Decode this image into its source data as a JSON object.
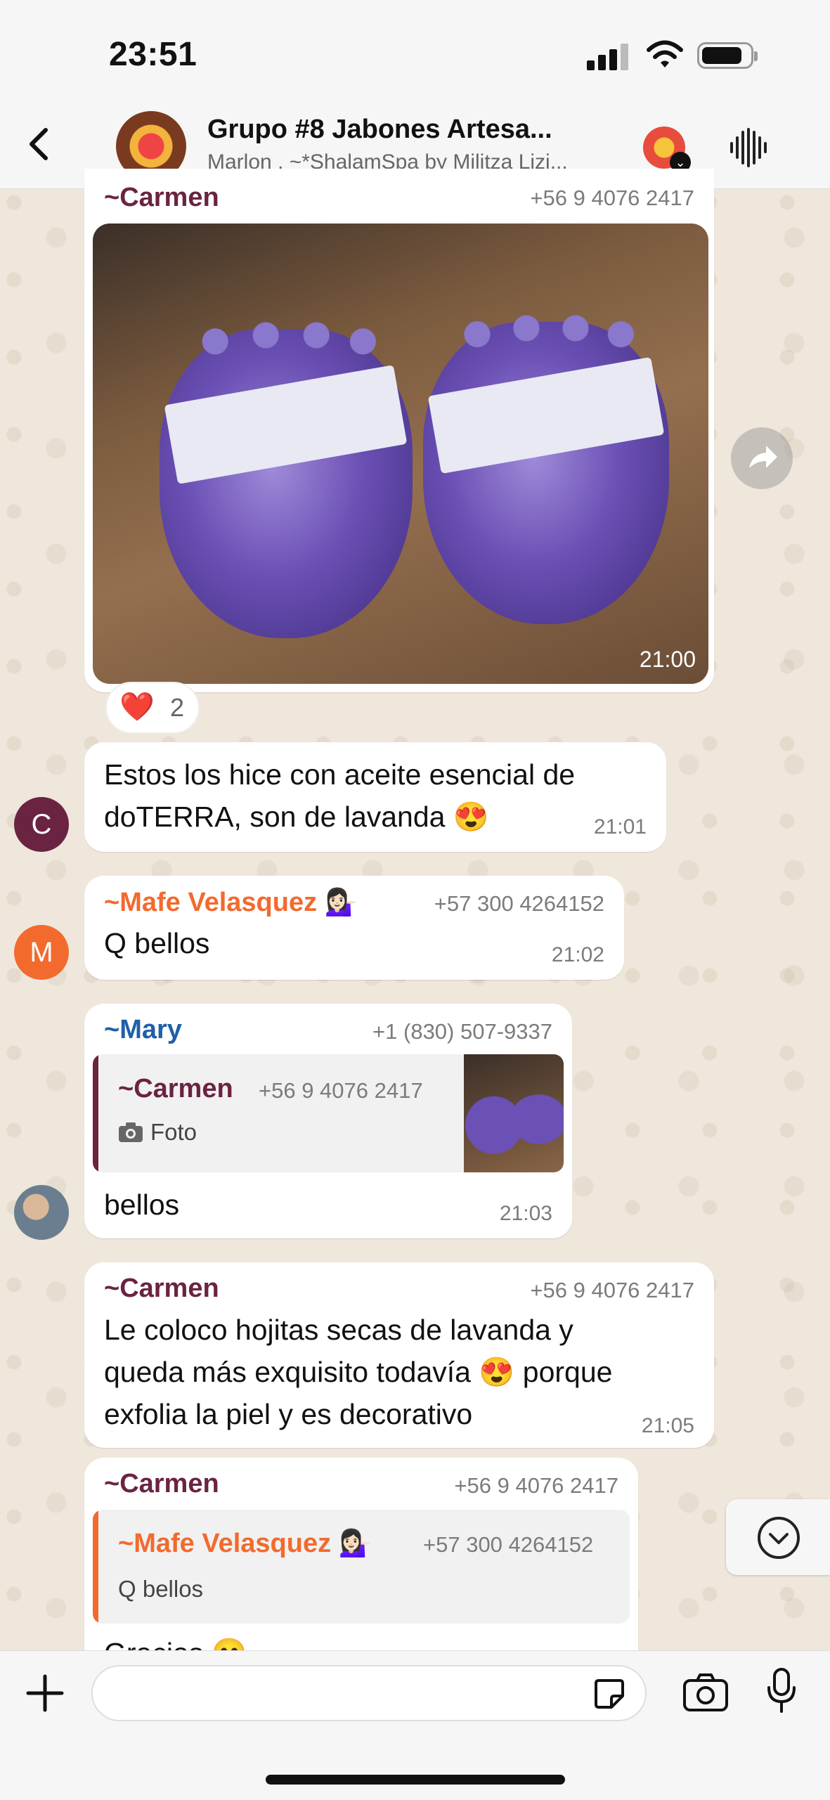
{
  "status_bar": {
    "time": "23:51"
  },
  "header": {
    "title": "Grupo #8 Jabones Artesa...",
    "subtitle": "Marlon , ~*ShalamSpa by Militza Lizi..."
  },
  "messages": [
    {
      "sender": "~Carmen",
      "phone": "+56 9 4076 2417",
      "image_time": "21:00",
      "reaction": {
        "emoji": "❤️",
        "count": "2"
      }
    },
    {
      "text_lines": [
        "Estos los hice con aceite esencial de",
        "doTERRA, son de lavanda 😍"
      ],
      "time": "21:01",
      "avatar_letter": "C"
    },
    {
      "sender": "~Mafe Velasquez 💁🏻‍♀️",
      "phone": "+57 300 4264152",
      "text": "Q bellos",
      "time": "21:02",
      "avatar_letter": "M"
    },
    {
      "sender": "~Mary",
      "phone": "+1 (830) 507-9337",
      "quote": {
        "sender": "~Carmen",
        "phone": "+56 9 4076 2417",
        "text": "Foto"
      },
      "text": "bellos",
      "time": "21:03"
    },
    {
      "sender": "~Carmen",
      "phone": "+56 9 4076 2417",
      "text_lines": [
        "Le coloco hojitas secas de lavanda y",
        "queda más exquisito todavía 😍 porque",
        "exfolia la piel y es decorativo"
      ],
      "time": "21:05"
    },
    {
      "sender": "~Carmen",
      "phone": "+56 9 4076 2417",
      "quote": {
        "sender": "~Mafe Velasquez 💁🏻‍♀️",
        "phone": "+57 300 4264152",
        "text": "Q bellos"
      },
      "text_partial": "Gracias 😊"
    }
  ],
  "colors": {
    "carmen": "#6b2342",
    "mafe": "#f26a2e",
    "mary": "#1f5fa8",
    "avatar_carmen": "#6b2342",
    "avatar_mafe": "#f26a2e"
  }
}
